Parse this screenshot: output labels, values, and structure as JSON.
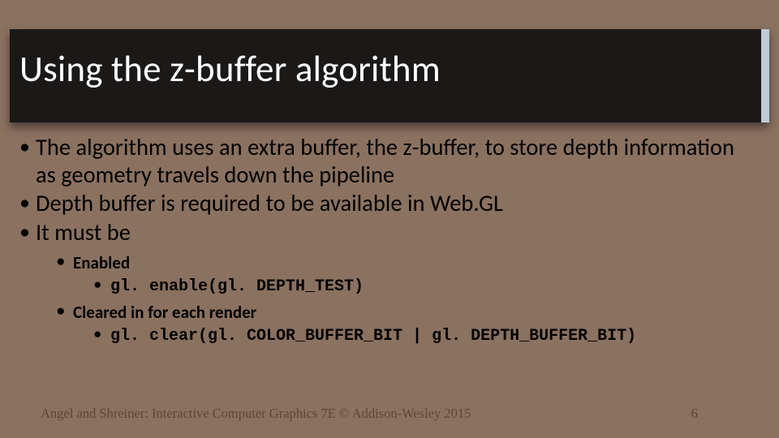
{
  "title": "Using the z-buffer algorithm",
  "bullets": {
    "b1": "The algorithm uses an extra buffer, the z-buffer, to store depth information as geometry travels down the pipeline",
    "b2": "Depth buffer is required to be available in Web.GL",
    "b3": "It must be",
    "b3a": "Enabled",
    "b3a1": "gl. enable(gl. DEPTH_TEST)",
    "b3b": "Cleared in for each render",
    "b3b1": "gl. clear(gl. COLOR_BUFFER_BIT | gl. DEPTH_BUFFER_BIT)"
  },
  "footer": {
    "attribution": "Angel and Shreiner: Interactive Computer Graphics 7E © Addison-Wesley 2015",
    "page": "6"
  }
}
